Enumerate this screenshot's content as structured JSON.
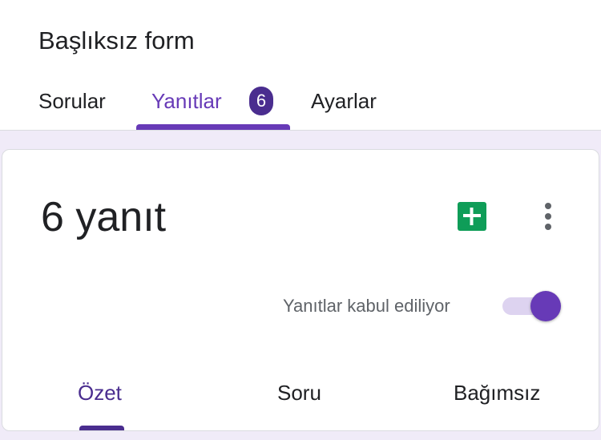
{
  "form": {
    "title": "Başlıksız form"
  },
  "tabs": [
    {
      "label": "Sorular",
      "active": false
    },
    {
      "label": "Yanıtlar",
      "active": true,
      "badge": "6"
    },
    {
      "label": "Ayarlar",
      "active": false
    }
  ],
  "responses": {
    "count_title": "6 yanıt",
    "accepting_label": "Yanıtlar kabul ediliyor",
    "accepting": true,
    "sheets_icon": "sheets-icon",
    "more_icon": "more-vert-icon",
    "subtabs": [
      {
        "label": "Özet",
        "active": true
      },
      {
        "label": "Soru",
        "active": false
      },
      {
        "label": "Bağımsız",
        "active": false
      }
    ]
  },
  "colors": {
    "accent": "#673ab7",
    "accent_dark": "#4a2d8f",
    "sheets_green": "#0f9d58",
    "page_background": "#f0ebf8"
  }
}
